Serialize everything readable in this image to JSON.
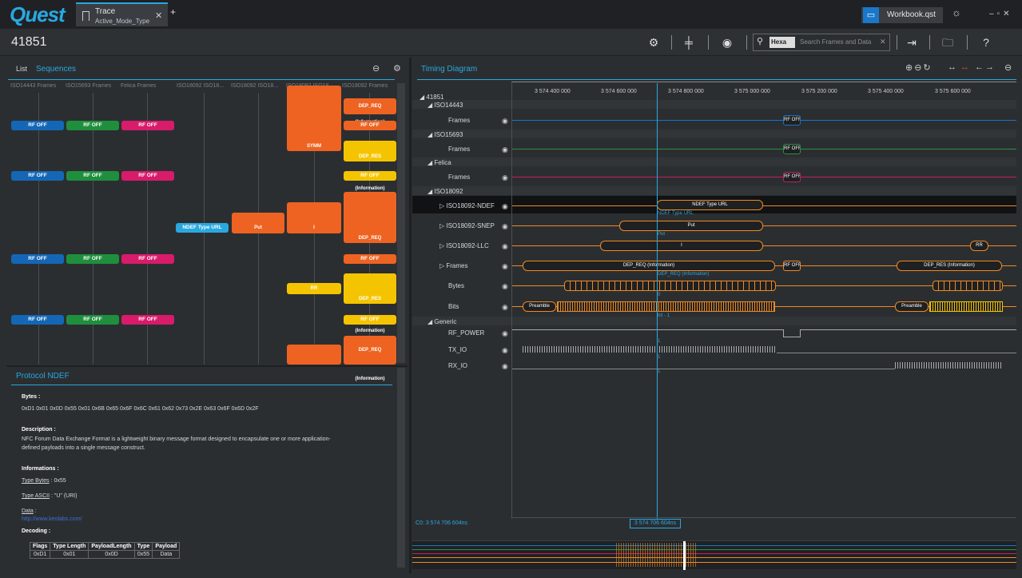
{
  "app": {
    "logo": "Quest"
  },
  "tab": {
    "title": "Trace",
    "subtitle": "Active_Mode_Type"
  },
  "workbook": {
    "label": "Workbook.qst"
  },
  "header": {
    "record_id": "41851"
  },
  "search": {
    "mode": "Hexa",
    "placeholder": "Search Frames and Data"
  },
  "left": {
    "tab_list": "List",
    "tab_sequences": "Sequences",
    "columns": [
      "ISO14443 Frames",
      "ISO15693 Frames",
      "Felica Frames",
      "ISO18092 ISO18...",
      "ISO18092 ISO18...",
      "ISO18092 ISO18...",
      "ISO18092 Frames"
    ]
  },
  "seq": {
    "rf_off": "RF OFF",
    "dep_req": "DEP_REQ (Information)",
    "dep_res": "DEP_RES (Information)",
    "symm": "SYMM",
    "ndef": "NDEF Type URL",
    "put": "Put",
    "i": "I",
    "rr": "RR"
  },
  "protocol": {
    "title": "Protocol NDEF",
    "bytes_label": "Bytes :",
    "bytes": "0xD1 0x01 0x0D 0x55 0x01 0x6B 0x65 0x6F 0x6C 0x61 0x62 0x73 0x2E 0x63 0x6F 0x6D 0x2F",
    "desc_label": "Description :",
    "desc1": "NFC Forum Data Exchange Format is a lightweight binary message format designed to encapsulate one or more application-",
    "desc2": "defined payloads into a single message construct.",
    "info_label": "Informations :",
    "type_bytes_k": "Type Bytes",
    "type_bytes_v": " : 0x55",
    "type_ascii_k": "Type ASCII",
    "type_ascii_v": " : \"U\" (URI)",
    "data_k": "Data",
    "data_colon": " :",
    "data_v": "http://www.keolabs.com/",
    "decoding_label": "Decoding :",
    "table": {
      "headers": [
        "Flags",
        "Type Length",
        "PayloadLength",
        "Type",
        "Payload"
      ],
      "row": [
        "0xD1",
        "0x01",
        "0x0D",
        "0x55",
        "Data"
      ]
    }
  },
  "timing": {
    "title": "Timing Diagram",
    "ticks": [
      "3 574 400 000",
      "3 574 600 000",
      "3 574 800 000",
      "3 575 000 000",
      "3 575 200 000",
      "3 575 400 000",
      "3 575 600 000"
    ],
    "tree": {
      "root": "41851",
      "iso14443": "ISO14443",
      "iso15693": "ISO15693",
      "felica": "Felica",
      "iso18092": "ISO18092",
      "frames": "Frames",
      "ndef": "ISO18092-NDEF",
      "snep": "ISO18092-SNEP",
      "llc": "ISO18092-LLC",
      "bytes": "Bytes",
      "bits": "Bits",
      "generic": "Generic",
      "rf_power": "RF_POWER",
      "tx_io": "TX_IO",
      "rx_io": "RX_IO"
    },
    "labels": {
      "rf_off": "RF OFF",
      "ndef_url": "NDEF Type URL",
      "put": "Put",
      "i": "I",
      "rr": "RR",
      "dep_req": "DEP_REQ (Information)",
      "dep_res": "DEP_RES (Information)",
      "preamble": "Preamble",
      "one": "1",
      "zero": "0",
      "bit1": "bit - 1"
    },
    "cursor_left": "C0: 3 574 706 604ns",
    "cursor_center": "3 574 706 604ns"
  },
  "colors": {
    "accent": "#29a8e0",
    "blue": "#1467b6",
    "green": "#1f8f3e",
    "pink": "#d81b6a",
    "orange": "#ee6322",
    "yellow": "#f5c400"
  }
}
